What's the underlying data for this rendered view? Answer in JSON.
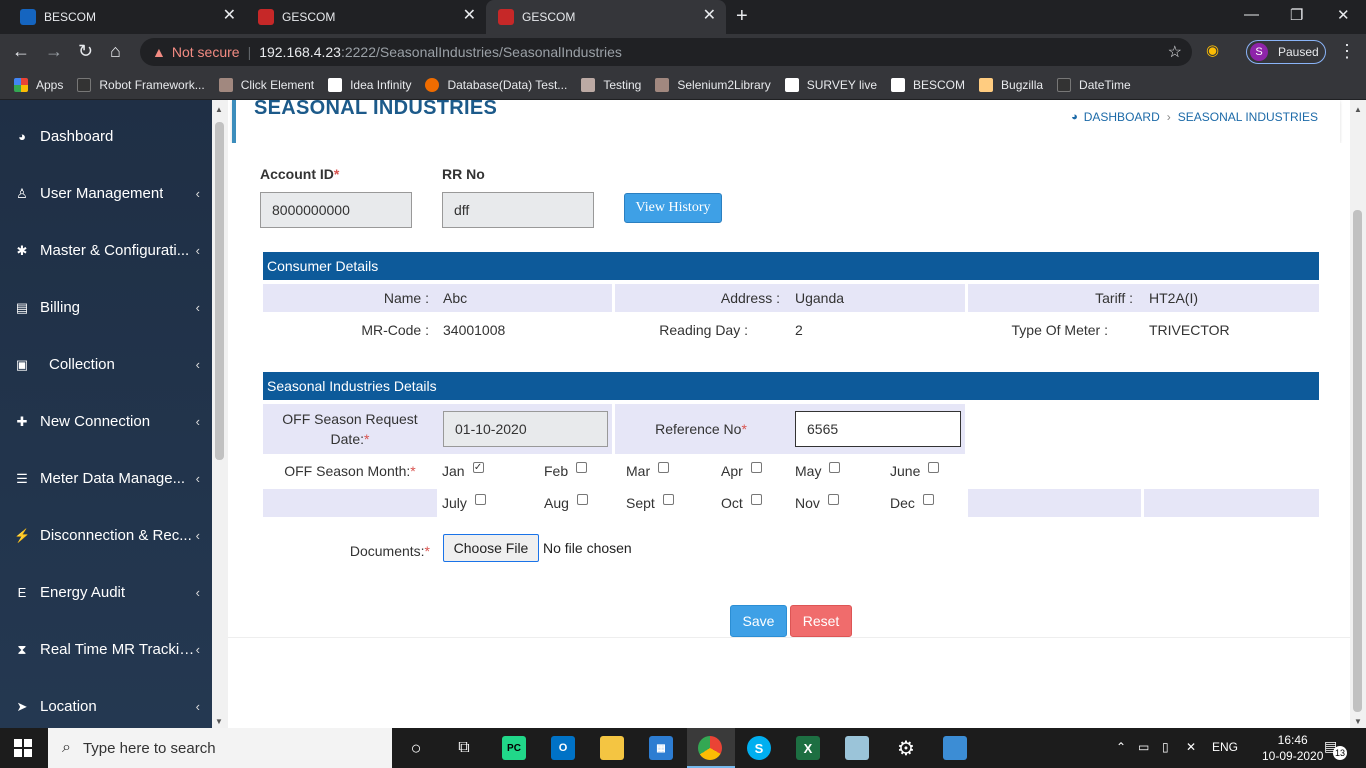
{
  "browser": {
    "tabs": [
      {
        "title": "BESCOM",
        "favicon_color": "#1565c0"
      },
      {
        "title": "GESCOM",
        "favicon_color": "#c62828"
      },
      {
        "title": "GESCOM",
        "favicon_color": "#c62828"
      }
    ],
    "security_label": "Not secure",
    "url_host": "192.168.4.23",
    "url_rest": ":2222/SeasonalIndustries/SeasonalIndustries",
    "profile_initial": "S",
    "profile_status": "Paused",
    "bookmarks": [
      "Apps",
      "Robot Framework...",
      "Click Element",
      "Idea Infinity",
      "Database(Data) Test...",
      "Testing",
      "Selenium2Library",
      "SURVEY live",
      "BESCOM",
      "Bugzilla",
      "DateTime"
    ]
  },
  "sidebar": {
    "items": [
      {
        "label": "Dashboard",
        "icon": "dashboard-icon",
        "glyph": "◕"
      },
      {
        "label": "User Management",
        "icon": "user-icon",
        "glyph": "♙"
      },
      {
        "label": "Master & Configurati...",
        "icon": "gear-icon",
        "glyph": "✱"
      },
      {
        "label": "Billing",
        "icon": "billing-icon",
        "glyph": "▤"
      },
      {
        "label": "Collection",
        "icon": "money-icon",
        "glyph": "▣"
      },
      {
        "label": "New Connection",
        "icon": "plus-icon",
        "glyph": "✚"
      },
      {
        "label": "Meter Data Manage...",
        "icon": "database-icon",
        "glyph": "☰"
      },
      {
        "label": "Disconnection & Rec...",
        "icon": "plug-icon",
        "glyph": "⚡"
      },
      {
        "label": "Energy Audit",
        "icon": "energy-icon",
        "glyph": "E"
      },
      {
        "label": "Real Time MR Tracking",
        "icon": "hourglass-icon",
        "glyph": "⧗"
      },
      {
        "label": "Location",
        "icon": "location-arrow-icon",
        "glyph": "➤"
      }
    ]
  },
  "page": {
    "title": "SEASONAL INDUSTRIES",
    "breadcrumb": [
      "DASHBOARD",
      "SEASONAL INDUSTRIES"
    ]
  },
  "form": {
    "account_id_label": "Account ID",
    "account_id_value": "8000000000",
    "rr_no_label": "RR No",
    "rr_no_value": "dff",
    "view_history_label": "View History"
  },
  "consumer_details": {
    "heading": "Consumer Details",
    "name_label": "Name :",
    "name_value": "Abc",
    "address_label": "Address :",
    "address_value": "Uganda",
    "tariff_label": "Tariff :",
    "tariff_value": "HT2A(I)",
    "mr_code_label": "MR-Code :",
    "mr_code_value": "34001008",
    "reading_day_label": "Reading Day :",
    "reading_day_value": "2",
    "meter_type_label": "Type Of Meter :",
    "meter_type_value": "TRIVECTOR"
  },
  "seasonal_details": {
    "heading": "Seasonal Industries Details",
    "request_date_label": "OFF Season Request Date:",
    "request_date_value": "01-10-2020",
    "reference_label": "Reference No",
    "reference_value": "6565",
    "month_label": "OFF Season Month:",
    "months": [
      {
        "label": "Jan",
        "checked": true
      },
      {
        "label": "Feb",
        "checked": false
      },
      {
        "label": "Mar",
        "checked": false
      },
      {
        "label": "Apr",
        "checked": false
      },
      {
        "label": "May",
        "checked": false
      },
      {
        "label": "June",
        "checked": false
      },
      {
        "label": "July",
        "checked": false
      },
      {
        "label": "Aug",
        "checked": false
      },
      {
        "label": "Sept",
        "checked": false
      },
      {
        "label": "Oct",
        "checked": false
      },
      {
        "label": "Nov",
        "checked": false
      },
      {
        "label": "Dec",
        "checked": false
      }
    ],
    "documents_label": "Documents:",
    "choose_file_label": "Choose File",
    "file_status": "No file chosen"
  },
  "actions": {
    "save_label": "Save",
    "reset_label": "Reset"
  },
  "taskbar": {
    "search_placeholder": "Type here to search",
    "language": "ENG",
    "time": "16:46",
    "date": "10-09-2020",
    "notification_count": "13"
  },
  "colors": {
    "sidebar_bg": "#1f2f45",
    "section_header": "#0d5a9a",
    "primary_button": "#3ea0e6",
    "reset_button": "#f06c6c",
    "required": "#d9534f"
  }
}
